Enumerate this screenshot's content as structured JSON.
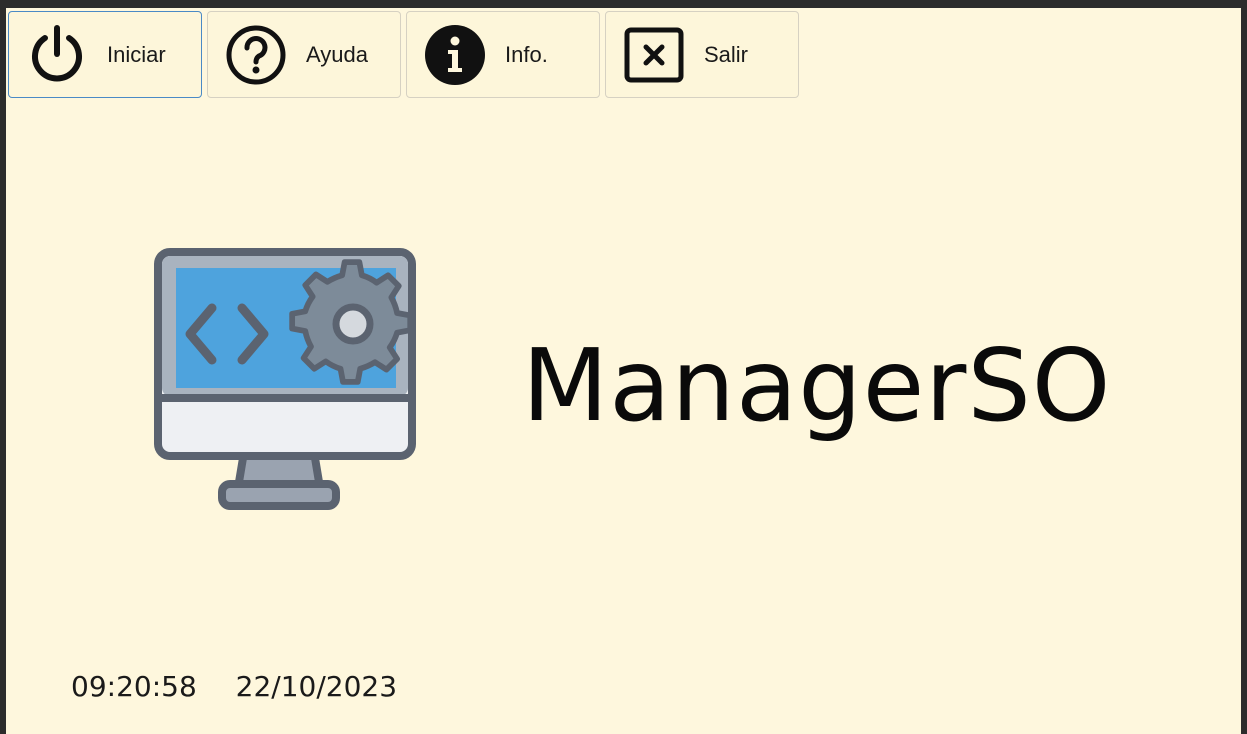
{
  "toolbar": {
    "buttons": [
      {
        "label": "Iniciar",
        "icon": "power-icon"
      },
      {
        "label": "Ayuda",
        "icon": "help-circle-icon"
      },
      {
        "label": "Info.",
        "icon": "info-icon"
      },
      {
        "label": "Salir",
        "icon": "close-box-icon"
      }
    ]
  },
  "app": {
    "title": "ManagerSO",
    "logo_icon": "monitor-code-gear-icon"
  },
  "status": {
    "time": "09:20:58",
    "date": "22/10/2023"
  },
  "colors": {
    "background": "#fef7dd",
    "active_border": "#4a8ac6",
    "screen_blue": "#4ea3dd",
    "gear_gray": "#7d8b99",
    "outline": "#5b6370"
  }
}
